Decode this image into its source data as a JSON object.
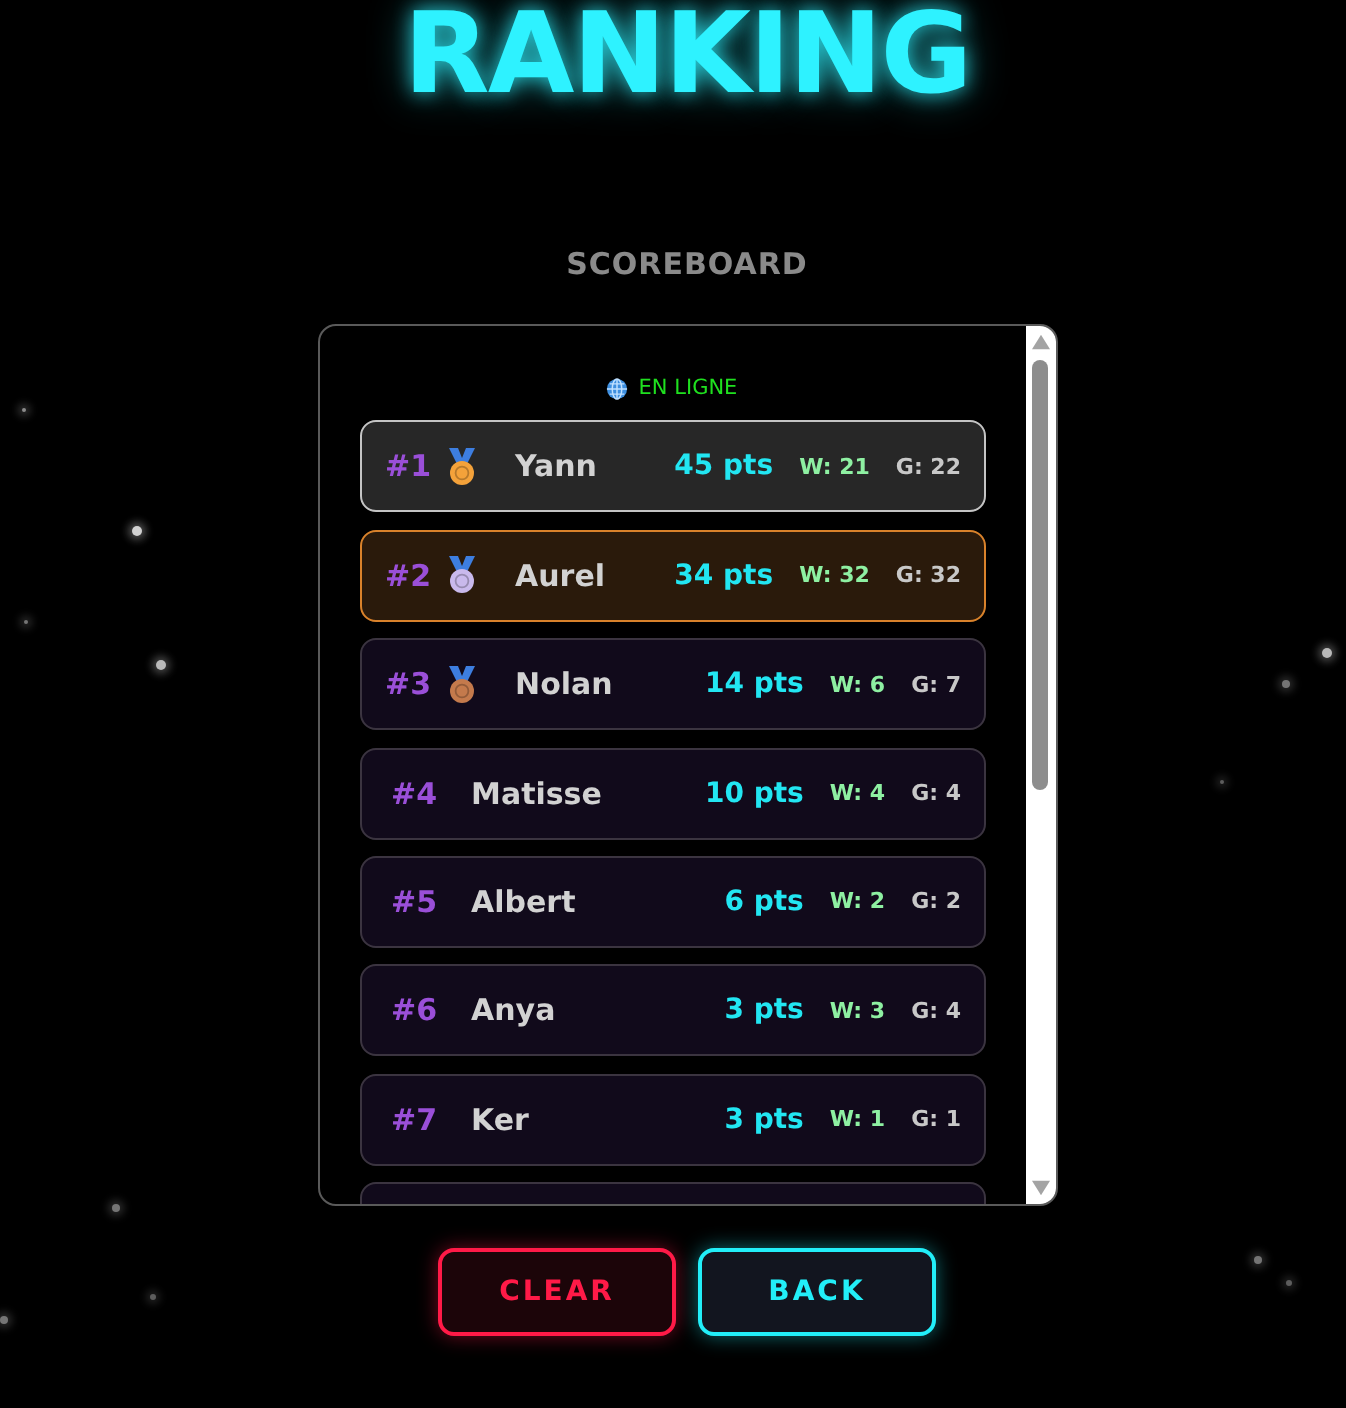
{
  "title": "RANKING",
  "subtitle": "SCOREBOARD",
  "status": {
    "label": "EN LIGNE"
  },
  "rows": [
    {
      "kind": "hovered",
      "rank": "#1",
      "medal": {
        "color": "#f4a23a"
      },
      "name": "Yann",
      "points": "45 pts",
      "wins": "W: 21",
      "games": "G: 22"
    },
    {
      "kind": "highlighted",
      "rank": "#2",
      "medal": {
        "color": "#c9b9ec"
      },
      "name": "Aurel",
      "points": "34 pts",
      "wins": "W: 32",
      "games": "G: 32"
    },
    {
      "kind": "plain",
      "rank": "#3",
      "medal": {
        "color": "#c47a4c"
      },
      "name": "Nolan",
      "points": "14 pts",
      "wins": "W: 6",
      "games": "G: 7"
    },
    {
      "kind": "plain",
      "rank": "#4",
      "name": "Matisse",
      "points": "10 pts",
      "wins": "W: 4",
      "games": "G: 4"
    },
    {
      "kind": "plain",
      "rank": "#5",
      "name": "Albert",
      "points": "6 pts",
      "wins": "W: 2",
      "games": "G: 2"
    },
    {
      "kind": "plain",
      "rank": "#6",
      "name": "Anya",
      "points": "3 pts",
      "wins": "W: 3",
      "games": "G: 4"
    },
    {
      "kind": "plain",
      "rank": "#7",
      "name": "Ker",
      "points": "3 pts",
      "wins": "W: 1",
      "games": "G: 1"
    }
  ],
  "buttons": [
    {
      "label": "CLEAR",
      "kind": "danger"
    },
    {
      "label": "BACK",
      "kind": "primary"
    }
  ]
}
